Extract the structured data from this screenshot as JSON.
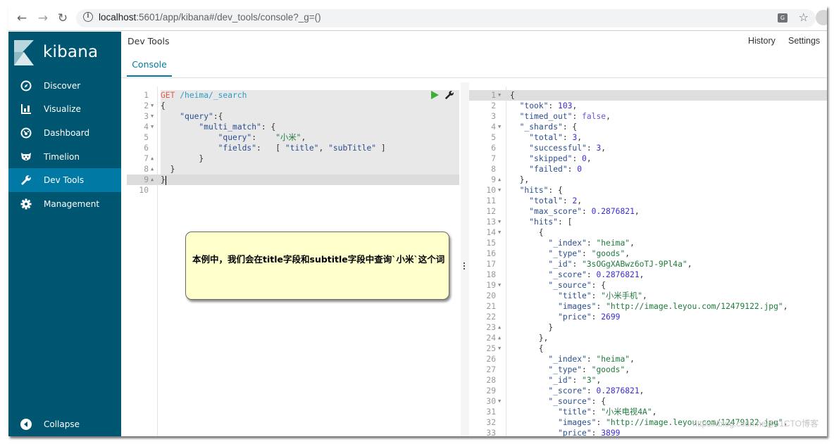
{
  "browser": {
    "url_host": "localhost",
    "url_rest": ":5601/app/kibana#/dev_tools/console?_g=()",
    "back_icon": "arrow-left-icon",
    "forward_icon": "arrow-right-icon",
    "reload_icon": "reload-icon",
    "translate_label": "G"
  },
  "sidebar": {
    "brand": "kibana",
    "items": [
      {
        "label": "Discover",
        "icon": "compass-icon",
        "active": false
      },
      {
        "label": "Visualize",
        "icon": "bar-chart-icon",
        "active": false
      },
      {
        "label": "Dashboard",
        "icon": "dashboard-icon",
        "active": false
      },
      {
        "label": "Timelion",
        "icon": "timelion-icon",
        "active": false
      },
      {
        "label": "Dev Tools",
        "icon": "wrench-icon",
        "active": true
      },
      {
        "label": "Management",
        "icon": "gear-icon",
        "active": false
      }
    ],
    "collapse_label": "Collapse",
    "colors": {
      "background": "#005571",
      "active": "#0079a5"
    }
  },
  "header": {
    "title": "Dev Tools",
    "history": "History",
    "settings": "Settings",
    "tabs": [
      {
        "label": "Console",
        "active": true
      }
    ]
  },
  "editor": {
    "lines": [
      {
        "n": "1",
        "fold": "",
        "tokens": [
          [
            "t-method",
            "GET"
          ],
          [
            "t-punc",
            " "
          ],
          [
            "t-url",
            "/heima/_search"
          ]
        ]
      },
      {
        "n": "2",
        "fold": "▼",
        "tokens": [
          [
            "t-punc",
            "{"
          ]
        ]
      },
      {
        "n": "3",
        "fold": "▼",
        "tokens": [
          [
            "t-punc",
            "    "
          ],
          [
            "t-key",
            "\"query\""
          ],
          [
            "t-punc",
            ":{"
          ]
        ]
      },
      {
        "n": "4",
        "fold": "▼",
        "tokens": [
          [
            "t-punc",
            "        "
          ],
          [
            "t-key",
            "\"multi_match\""
          ],
          [
            "t-punc",
            ": {"
          ]
        ]
      },
      {
        "n": "5",
        "fold": "",
        "tokens": [
          [
            "t-punc",
            "            "
          ],
          [
            "t-key",
            "\"query\""
          ],
          [
            "t-punc",
            ":    "
          ],
          [
            "t-str",
            "\"小米\""
          ],
          [
            "t-punc",
            ","
          ]
        ]
      },
      {
        "n": "6",
        "fold": "",
        "tokens": [
          [
            "t-punc",
            "            "
          ],
          [
            "t-key",
            "\"fields\""
          ],
          [
            "t-punc",
            ":   [ "
          ],
          [
            "t-key",
            "\"title\""
          ],
          [
            "t-punc",
            ", "
          ],
          [
            "t-key",
            "\"subTitle\""
          ],
          [
            "t-punc",
            " ]"
          ]
        ]
      },
      {
        "n": "7",
        "fold": "▲",
        "tokens": [
          [
            "t-punc",
            "        }"
          ]
        ]
      },
      {
        "n": "8",
        "fold": "▲",
        "tokens": [
          [
            "t-punc",
            "  }"
          ]
        ]
      },
      {
        "n": "9",
        "fold": "▲",
        "tokens": [
          [
            "t-punc",
            "}"
          ]
        ],
        "cursor": true
      },
      {
        "n": "10",
        "fold": "",
        "tokens": []
      }
    ]
  },
  "output": {
    "lines": [
      {
        "n": "1",
        "fold": "▼",
        "tokens": [
          [
            "t-punc",
            "{"
          ]
        ]
      },
      {
        "n": "2",
        "fold": "",
        "tokens": [
          [
            "t-punc",
            "  "
          ],
          [
            "t-key",
            "\"took\""
          ],
          [
            "t-punc",
            ": "
          ],
          [
            "t-num",
            "103"
          ],
          [
            "t-punc",
            ","
          ]
        ]
      },
      {
        "n": "3",
        "fold": "",
        "tokens": [
          [
            "t-punc",
            "  "
          ],
          [
            "t-key",
            "\"timed_out\""
          ],
          [
            "t-punc",
            ": "
          ],
          [
            "t-bool",
            "false"
          ],
          [
            "t-punc",
            ","
          ]
        ]
      },
      {
        "n": "4",
        "fold": "▼",
        "tokens": [
          [
            "t-punc",
            "  "
          ],
          [
            "t-key",
            "\"_shards\""
          ],
          [
            "t-punc",
            ": {"
          ]
        ]
      },
      {
        "n": "5",
        "fold": "",
        "tokens": [
          [
            "t-punc",
            "    "
          ],
          [
            "t-key",
            "\"total\""
          ],
          [
            "t-punc",
            ": "
          ],
          [
            "t-num",
            "3"
          ],
          [
            "t-punc",
            ","
          ]
        ]
      },
      {
        "n": "6",
        "fold": "",
        "tokens": [
          [
            "t-punc",
            "    "
          ],
          [
            "t-key",
            "\"successful\""
          ],
          [
            "t-punc",
            ": "
          ],
          [
            "t-num",
            "3"
          ],
          [
            "t-punc",
            ","
          ]
        ]
      },
      {
        "n": "7",
        "fold": "",
        "tokens": [
          [
            "t-punc",
            "    "
          ],
          [
            "t-key",
            "\"skipped\""
          ],
          [
            "t-punc",
            ": "
          ],
          [
            "t-num",
            "0"
          ],
          [
            "t-punc",
            ","
          ]
        ]
      },
      {
        "n": "8",
        "fold": "",
        "tokens": [
          [
            "t-punc",
            "    "
          ],
          [
            "t-key",
            "\"failed\""
          ],
          [
            "t-punc",
            ": "
          ],
          [
            "t-num",
            "0"
          ]
        ]
      },
      {
        "n": "9",
        "fold": "▲",
        "tokens": [
          [
            "t-punc",
            "  },"
          ]
        ]
      },
      {
        "n": "10",
        "fold": "▼",
        "tokens": [
          [
            "t-punc",
            "  "
          ],
          [
            "t-key",
            "\"hits\""
          ],
          [
            "t-punc",
            ": {"
          ]
        ]
      },
      {
        "n": "11",
        "fold": "",
        "tokens": [
          [
            "t-punc",
            "    "
          ],
          [
            "t-key",
            "\"total\""
          ],
          [
            "t-punc",
            ": "
          ],
          [
            "t-num",
            "2"
          ],
          [
            "t-punc",
            ","
          ]
        ]
      },
      {
        "n": "12",
        "fold": "",
        "tokens": [
          [
            "t-punc",
            "    "
          ],
          [
            "t-key",
            "\"max_score\""
          ],
          [
            "t-punc",
            ": "
          ],
          [
            "t-num",
            "0.2876821"
          ],
          [
            "t-punc",
            ","
          ]
        ]
      },
      {
        "n": "13",
        "fold": "▼",
        "tokens": [
          [
            "t-punc",
            "    "
          ],
          [
            "t-key",
            "\"hits\""
          ],
          [
            "t-punc",
            ": ["
          ]
        ]
      },
      {
        "n": "14",
        "fold": "▼",
        "tokens": [
          [
            "t-punc",
            "      {"
          ]
        ]
      },
      {
        "n": "15",
        "fold": "",
        "tokens": [
          [
            "t-punc",
            "        "
          ],
          [
            "t-key",
            "\"_index\""
          ],
          [
            "t-punc",
            ": "
          ],
          [
            "t-str",
            "\"heima\""
          ],
          [
            "t-punc",
            ","
          ]
        ]
      },
      {
        "n": "16",
        "fold": "",
        "tokens": [
          [
            "t-punc",
            "        "
          ],
          [
            "t-key",
            "\"_type\""
          ],
          [
            "t-punc",
            ": "
          ],
          [
            "t-str",
            "\"goods\""
          ],
          [
            "t-punc",
            ","
          ]
        ]
      },
      {
        "n": "17",
        "fold": "",
        "tokens": [
          [
            "t-punc",
            "        "
          ],
          [
            "t-key",
            "\"_id\""
          ],
          [
            "t-punc",
            ": "
          ],
          [
            "t-str",
            "\"3sOGgXABwz6oTJ-9Pl4a\""
          ],
          [
            "t-punc",
            ","
          ]
        ]
      },
      {
        "n": "18",
        "fold": "",
        "tokens": [
          [
            "t-punc",
            "        "
          ],
          [
            "t-key",
            "\"_score\""
          ],
          [
            "t-punc",
            ": "
          ],
          [
            "t-num",
            "0.2876821"
          ],
          [
            "t-punc",
            ","
          ]
        ]
      },
      {
        "n": "19",
        "fold": "▼",
        "tokens": [
          [
            "t-punc",
            "        "
          ],
          [
            "t-key",
            "\"_source\""
          ],
          [
            "t-punc",
            ": {"
          ]
        ]
      },
      {
        "n": "20",
        "fold": "",
        "tokens": [
          [
            "t-punc",
            "          "
          ],
          [
            "t-key",
            "\"title\""
          ],
          [
            "t-punc",
            ": "
          ],
          [
            "t-str",
            "\"小米手机\""
          ],
          [
            "t-punc",
            ","
          ]
        ]
      },
      {
        "n": "21",
        "fold": "",
        "tokens": [
          [
            "t-punc",
            "          "
          ],
          [
            "t-key",
            "\"images\""
          ],
          [
            "t-punc",
            ": "
          ],
          [
            "t-str",
            "\"http://image.leyou.com/12479122.jpg\""
          ],
          [
            "t-punc",
            ","
          ]
        ]
      },
      {
        "n": "22",
        "fold": "",
        "tokens": [
          [
            "t-punc",
            "          "
          ],
          [
            "t-key",
            "\"price\""
          ],
          [
            "t-punc",
            ": "
          ],
          [
            "t-num",
            "2699"
          ]
        ]
      },
      {
        "n": "23",
        "fold": "▲",
        "tokens": [
          [
            "t-punc",
            "        }"
          ]
        ]
      },
      {
        "n": "24",
        "fold": "▲",
        "tokens": [
          [
            "t-punc",
            "      },"
          ]
        ]
      },
      {
        "n": "25",
        "fold": "▼",
        "tokens": [
          [
            "t-punc",
            "      {"
          ]
        ]
      },
      {
        "n": "26",
        "fold": "",
        "tokens": [
          [
            "t-punc",
            "        "
          ],
          [
            "t-key",
            "\"_index\""
          ],
          [
            "t-punc",
            ": "
          ],
          [
            "t-str",
            "\"heima\""
          ],
          [
            "t-punc",
            ","
          ]
        ]
      },
      {
        "n": "27",
        "fold": "",
        "tokens": [
          [
            "t-punc",
            "        "
          ],
          [
            "t-key",
            "\"_type\""
          ],
          [
            "t-punc",
            ": "
          ],
          [
            "t-str",
            "\"goods\""
          ],
          [
            "t-punc",
            ","
          ]
        ]
      },
      {
        "n": "28",
        "fold": "",
        "tokens": [
          [
            "t-punc",
            "        "
          ],
          [
            "t-key",
            "\"_id\""
          ],
          [
            "t-punc",
            ": "
          ],
          [
            "t-str",
            "\"3\""
          ],
          [
            "t-punc",
            ","
          ]
        ]
      },
      {
        "n": "29",
        "fold": "",
        "tokens": [
          [
            "t-punc",
            "        "
          ],
          [
            "t-key",
            "\"_score\""
          ],
          [
            "t-punc",
            ": "
          ],
          [
            "t-num",
            "0.2876821"
          ],
          [
            "t-punc",
            ","
          ]
        ]
      },
      {
        "n": "30",
        "fold": "▼",
        "tokens": [
          [
            "t-punc",
            "        "
          ],
          [
            "t-key",
            "\"_source\""
          ],
          [
            "t-punc",
            ": {"
          ]
        ]
      },
      {
        "n": "31",
        "fold": "",
        "tokens": [
          [
            "t-punc",
            "          "
          ],
          [
            "t-key",
            "\"title\""
          ],
          [
            "t-punc",
            ": "
          ],
          [
            "t-str",
            "\"小米电视4A\""
          ],
          [
            "t-punc",
            ","
          ]
        ]
      },
      {
        "n": "32",
        "fold": "",
        "tokens": [
          [
            "t-punc",
            "          "
          ],
          [
            "t-key",
            "\"images\""
          ],
          [
            "t-punc",
            ": "
          ],
          [
            "t-str",
            "\"http://image.leyou.com/12479122.jpg\""
          ],
          [
            "t-punc",
            ","
          ]
        ]
      },
      {
        "n": "33",
        "fold": "",
        "tokens": [
          [
            "t-punc",
            "          "
          ],
          [
            "t-key",
            "\"price\""
          ],
          [
            "t-punc",
            ": "
          ],
          [
            "t-num",
            "3899"
          ]
        ]
      }
    ]
  },
  "callout": {
    "text": "本例中，我们会在title字段和subtitle字段中查询`小米`这个词"
  },
  "watermark": "https://blog.csdn.ne@51CTO博客"
}
